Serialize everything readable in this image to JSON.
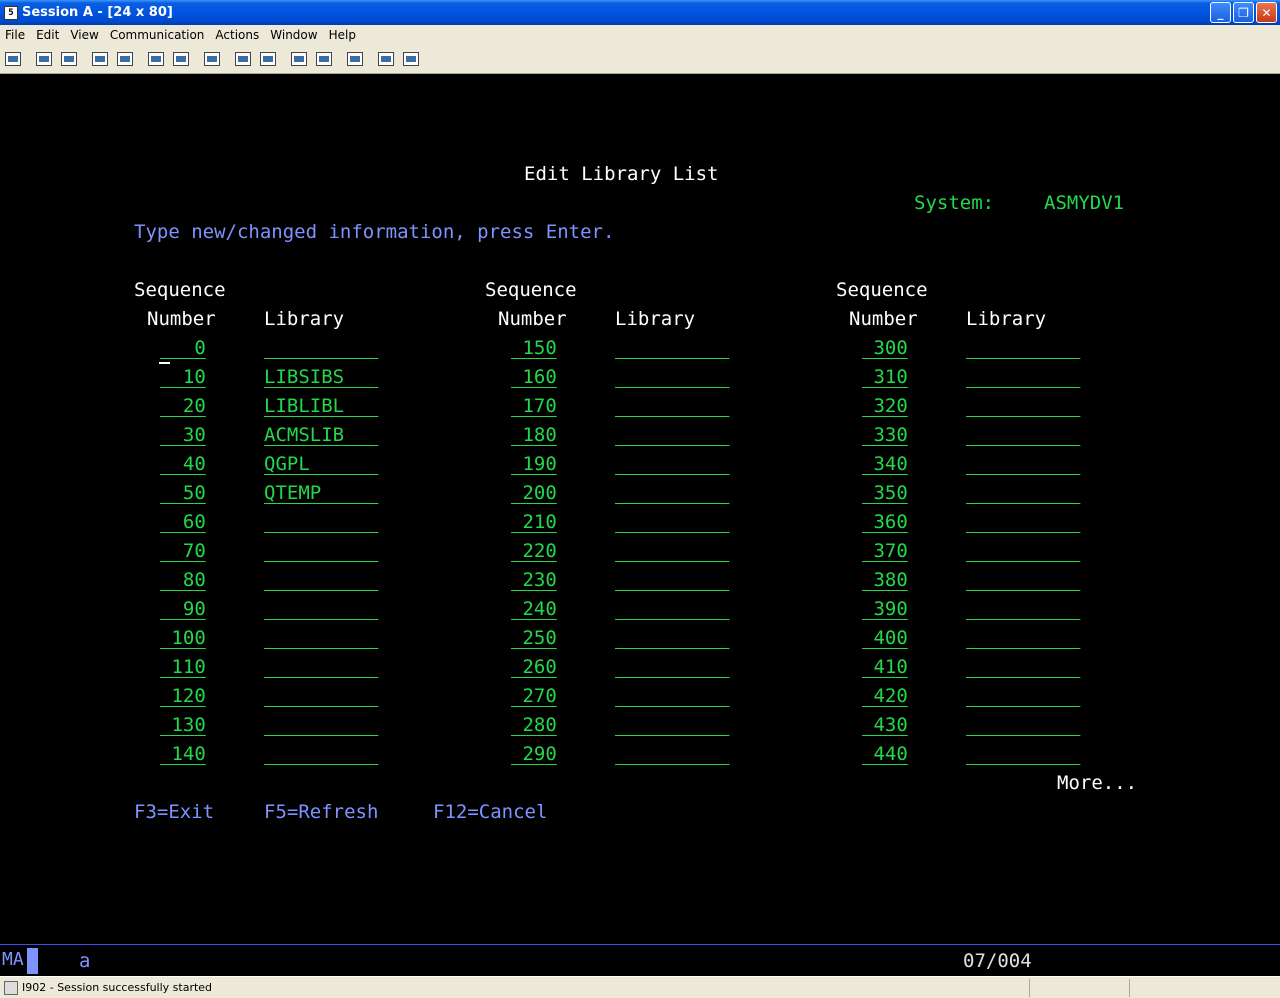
{
  "window": {
    "title": "Session A - [24 x 80]",
    "icon_glyph": "5",
    "min_glyph": "_",
    "max_glyph": "❐",
    "close_glyph": "✕"
  },
  "menu": [
    "File",
    "Edit",
    "View",
    "Communication",
    "Actions",
    "Window",
    "Help"
  ],
  "toolbar": {
    "icons": [
      "print-screen-icon",
      "copy-icon",
      "paste-icon",
      "send-icon",
      "receive-icon",
      "display-icon",
      "keypad-icon",
      "chart-icon",
      "record-macro-icon",
      "stop-macro-icon",
      "play-macro-icon",
      "macro-edit-icon",
      "clipboard-icon",
      "globe-icon",
      "support-icon"
    ]
  },
  "screen": {
    "title": "Edit Library List",
    "system_label": "System:",
    "system_name": "ASMYDV1",
    "instruction": "Type new/changed information, press Enter.",
    "header_sequence": "Sequence",
    "header_number": "Number",
    "header_library": "Library",
    "columns": [
      {
        "rows": [
          {
            "seq": "   0",
            "lib": "          "
          },
          {
            "seq": "  10",
            "lib": "LIBSIBS   "
          },
          {
            "seq": "  20",
            "lib": "LIBLIBL   "
          },
          {
            "seq": "  30",
            "lib": "ACMSLIB   "
          },
          {
            "seq": "  40",
            "lib": "QGPL      "
          },
          {
            "seq": "  50",
            "lib": "QTEMP     "
          },
          {
            "seq": "  60",
            "lib": "          "
          },
          {
            "seq": "  70",
            "lib": "          "
          },
          {
            "seq": "  80",
            "lib": "          "
          },
          {
            "seq": "  90",
            "lib": "          "
          },
          {
            "seq": " 100",
            "lib": "          "
          },
          {
            "seq": " 110",
            "lib": "          "
          },
          {
            "seq": " 120",
            "lib": "          "
          },
          {
            "seq": " 130",
            "lib": "          "
          },
          {
            "seq": " 140",
            "lib": "          "
          }
        ]
      },
      {
        "rows": [
          {
            "seq": " 150",
            "lib": "          "
          },
          {
            "seq": " 160",
            "lib": "          "
          },
          {
            "seq": " 170",
            "lib": "          "
          },
          {
            "seq": " 180",
            "lib": "          "
          },
          {
            "seq": " 190",
            "lib": "          "
          },
          {
            "seq": " 200",
            "lib": "          "
          },
          {
            "seq": " 210",
            "lib": "          "
          },
          {
            "seq": " 220",
            "lib": "          "
          },
          {
            "seq": " 230",
            "lib": "          "
          },
          {
            "seq": " 240",
            "lib": "          "
          },
          {
            "seq": " 250",
            "lib": "          "
          },
          {
            "seq": " 260",
            "lib": "          "
          },
          {
            "seq": " 270",
            "lib": "          "
          },
          {
            "seq": " 280",
            "lib": "          "
          },
          {
            "seq": " 290",
            "lib": "          "
          }
        ]
      },
      {
        "rows": [
          {
            "seq": " 300",
            "lib": "          "
          },
          {
            "seq": " 310",
            "lib": "          "
          },
          {
            "seq": " 320",
            "lib": "          "
          },
          {
            "seq": " 330",
            "lib": "          "
          },
          {
            "seq": " 340",
            "lib": "          "
          },
          {
            "seq": " 350",
            "lib": "          "
          },
          {
            "seq": " 360",
            "lib": "          "
          },
          {
            "seq": " 370",
            "lib": "          "
          },
          {
            "seq": " 380",
            "lib": "          "
          },
          {
            "seq": " 390",
            "lib": "          "
          },
          {
            "seq": " 400",
            "lib": "          "
          },
          {
            "seq": " 410",
            "lib": "          "
          },
          {
            "seq": " 420",
            "lib": "          "
          },
          {
            "seq": " 430",
            "lib": "          "
          },
          {
            "seq": " 440",
            "lib": "          "
          }
        ]
      }
    ],
    "more": "More...",
    "fkeys": [
      "F3=Exit",
      "F5=Refresh",
      "F12=Cancel"
    ]
  },
  "oia": {
    "mode": "MA",
    "keyboard": "a",
    "cursor_position": "07/004"
  },
  "status": {
    "message": "I902 - Session successfully started"
  },
  "colors": {
    "field_green": "#23d84a",
    "prompt_blue": "#7f93ff",
    "title_white": "#ffffff"
  }
}
